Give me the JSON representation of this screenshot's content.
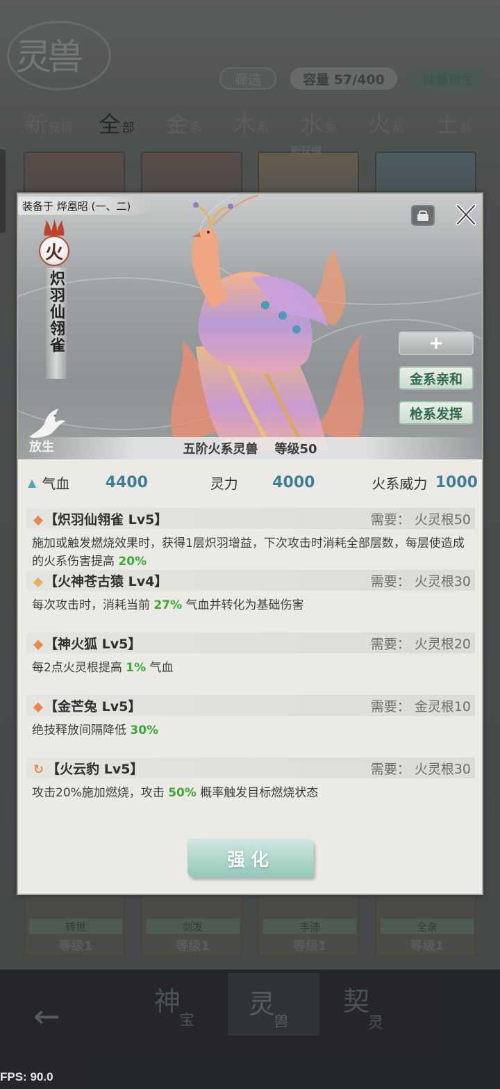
{
  "background": {
    "logo_title": "灵兽",
    "filter_label": "筛选",
    "capacity_label": "容量 57/400",
    "batch_release_label": "批量放生",
    "tabs": [
      {
        "big": "新",
        "small": "获得"
      },
      {
        "big": "全",
        "small": "部"
      },
      {
        "big": "金",
        "small": "系"
      },
      {
        "big": "木",
        "small": "系"
      },
      {
        "big": "水",
        "small": "系"
      },
      {
        "big": "火",
        "small": "系"
      },
      {
        "big": "土",
        "small": "系"
      }
    ],
    "new_tag": "新获得",
    "bottom_cards": [
      {
        "tag": "转世",
        "level": "等级1"
      },
      {
        "tag": "剑发",
        "level": "等级1"
      },
      {
        "tag": "丰沛",
        "level": "等级1"
      },
      {
        "tag": "全亲",
        "level": "等级1"
      }
    ],
    "nav": [
      {
        "big": "神",
        "small": "宝"
      },
      {
        "big": "灵",
        "small": "兽"
      },
      {
        "big": "契",
        "small": "灵"
      }
    ]
  },
  "fps": "FPS: 90.0",
  "modal": {
    "equipped_on": "装备于 烨凰昭 (一、二)",
    "element": "火",
    "beast_name": "炽羽仙翎雀",
    "release_label": "放生",
    "side_buttons": {
      "plus": "+",
      "metal_affinity": "金系亲和",
      "gun_mastery": "枪系发挥"
    },
    "caption_rank": "五阶火系灵兽",
    "caption_level": "等级50",
    "stats": {
      "hp_label": "气血",
      "hp_value": "4400",
      "spirit_label": "灵力",
      "spirit_value": "4000",
      "fire_label": "火系威力",
      "fire_value": "1000"
    },
    "skills": [
      {
        "name": "【炽羽仙翎雀 Lv5】",
        "req": "需要：  火灵根50",
        "desc_pre": "施加或触发燃烧效果时，获得1层炽羽增益，下次攻击时消耗全部层数，每层使造成的火系伤害提高 ",
        "desc_hl": "20%",
        "desc_post": ""
      },
      {
        "name": "【火神苍古猿 Lv4】",
        "req": "需要：  火灵根30",
        "desc_pre": "每次攻击时，消耗当前 ",
        "desc_hl": "27%",
        "desc_post": " 气血并转化为基础伤害"
      },
      {
        "name": "【神火狐 Lv5】",
        "req": "需要：  火灵根20",
        "desc_pre": "每2点火灵根提高 ",
        "desc_hl": "1%",
        "desc_post": " 气血"
      },
      {
        "name": "【金芒兔 Lv5】",
        "req": "需要：  金灵根10",
        "desc_pre": "绝技释放间隔降低 ",
        "desc_hl": "30%",
        "desc_post": ""
      },
      {
        "name": "【火云豹 Lv5】",
        "req": "需要：  火灵根30",
        "desc_pre": "攻击20%施加燃烧，攻击 ",
        "desc_hl": "50%",
        "desc_post": " 概率触发目标燃烧状态"
      }
    ],
    "strengthen_label": "强化"
  },
  "colors": {
    "accent_teal": "#3e7f95",
    "highlight_green": "#3ba838",
    "fire_diamond": "#e8894a",
    "gold_diamond": "#d9b85a",
    "button_green_text": "#2f6b48"
  }
}
